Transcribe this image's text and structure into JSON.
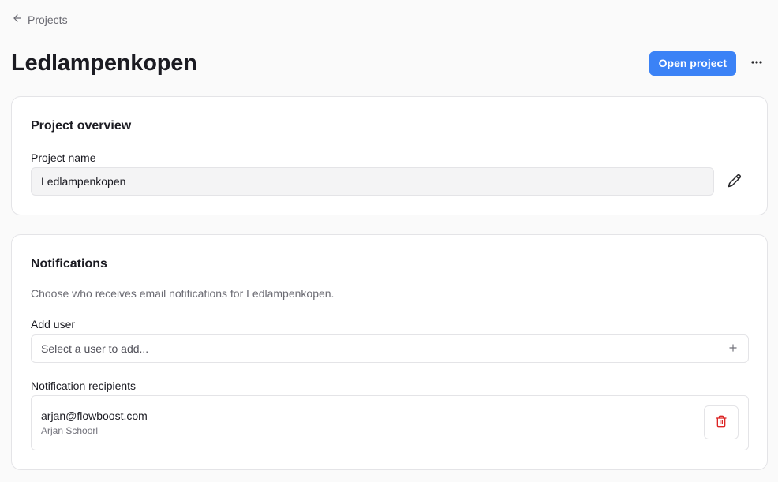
{
  "breadcrumb": {
    "label": "Projects",
    "icon": "arrow-left-icon"
  },
  "header": {
    "title": "Ledlampenkopen",
    "open_project_label": "Open project",
    "more_icon": "more-horizontal-icon"
  },
  "overview": {
    "title": "Project overview",
    "name_label": "Project name",
    "name_value": "Ledlampenkopen",
    "edit_icon": "pencil-icon"
  },
  "notifications": {
    "title": "Notifications",
    "description": "Choose who receives email notifications for Ledlampenkopen.",
    "add_user_label": "Add user",
    "add_user_placeholder": "Select a user to add...",
    "recipients_label": "Notification recipients",
    "recipients": [
      {
        "email": "arjan@flowboost.com",
        "name": "Arjan Schoorl"
      }
    ]
  },
  "colors": {
    "accent": "#3b82f6",
    "danger": "#dc2626",
    "background": "#fafafa"
  }
}
